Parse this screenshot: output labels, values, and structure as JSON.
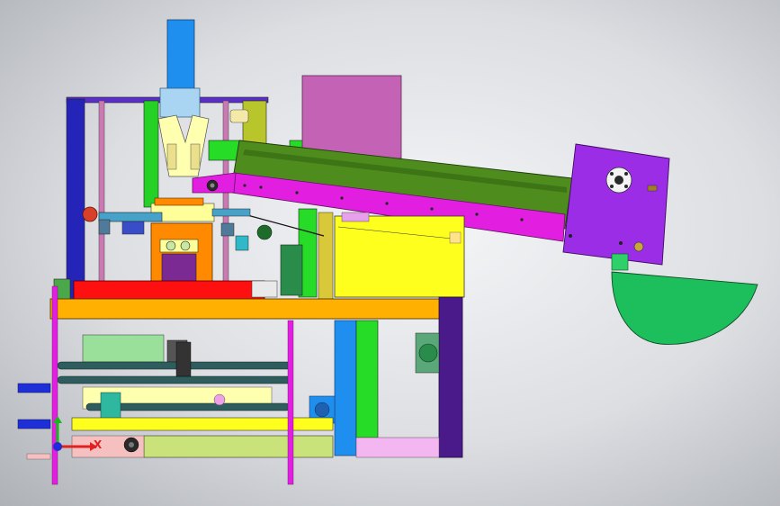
{
  "axis_triad": {
    "x_label": "X",
    "x_color": "#e0211e",
    "y_color": "#19b61d",
    "z_color": "#1d2bd8"
  },
  "palette": {
    "frame_orange": "#ffb000",
    "conveyor_green": "#4e8c1e",
    "conveyor_rail": "#e21ee0",
    "hopper_blue": "#1f8fef",
    "motor_purple": "#9b2de6",
    "bin_green": "#1dbe5c",
    "tank_pink": "#c463b6",
    "yellow_housing": "#ffff1e",
    "frame_navy": "#1f1fa8"
  }
}
